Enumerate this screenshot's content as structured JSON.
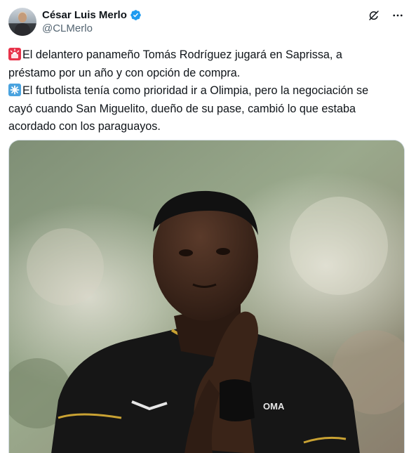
{
  "author": {
    "display_name": "César Luis Merlo",
    "handle": "@CLMerlo",
    "verified": true,
    "verified_color": "#1d9bf0"
  },
  "icons": {
    "grok": "grok-icon",
    "more": "more-icon",
    "verified": "verified-badge-icon"
  },
  "tweet": {
    "line1_emoji": "rotating-light",
    "line1_text": "El delantero panameño Tomás Rodríguez jugará en Saprissa, a",
    "line2_text": "préstamo por un año y con opción de compra.",
    "line3_emoji": "eight-spoked-asterisk",
    "line3_text": "El futbolista tenía como prioridad ir a Olimpia, pero la negociación se",
    "line4_text": "cayó cuando San Miguelito, dueño de su pase, cambió lo que estaba",
    "line5_text": "acordado con los paraguayos."
  },
  "media": {
    "jersey_text": "OMA"
  },
  "colors": {
    "text": "#0f1419",
    "secondary": "#536471",
    "accent_red": "#e8334a",
    "accent_blue": "#4aa3df",
    "jersey": "#161616",
    "jersey_trim": "#c9a233"
  }
}
